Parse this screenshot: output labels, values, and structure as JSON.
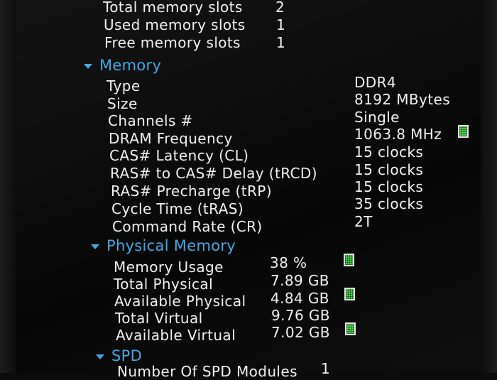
{
  "slots": {
    "total_label": "Total memory slots",
    "total_value": "2",
    "used_label": "Used memory slots",
    "used_value": "1",
    "free_label": "Free memory slots",
    "free_value": "1"
  },
  "memory": {
    "title": "Memory",
    "type_label": "Type",
    "type_value": "DDR4",
    "size_label": "Size",
    "size_value": "8192 MBytes",
    "channels_label": "Channels #",
    "channels_value": "Single",
    "freq_label": "DRAM Frequency",
    "freq_value": "1063.8 MHz",
    "cas_label": "CAS# Latency (CL)",
    "cas_value": "15 clocks",
    "trcd_label": "RAS# to CAS# Delay (tRCD)",
    "trcd_value": "15 clocks",
    "trp_label": "RAS# Precharge (tRP)",
    "trp_value": "15 clocks",
    "tras_label": "Cycle Time (tRAS)",
    "tras_value": "35 clocks",
    "cr_label": "Command Rate (CR)",
    "cr_value": "2T"
  },
  "physical": {
    "title": "Physical Memory",
    "usage_label": "Memory Usage",
    "usage_value": "38 %",
    "total_phys_label": "Total Physical",
    "total_phys_value": "7.89 GB",
    "avail_phys_label": "Available Physical",
    "avail_phys_value": "4.84 GB",
    "total_virt_label": "Total Virtual",
    "total_virt_value": "9.76 GB",
    "avail_virt_label": "Available Virtual",
    "avail_virt_value": "7.02 GB"
  },
  "spd": {
    "title": "SPD",
    "modules_label": "Number Of SPD Modules",
    "modules_value": "1"
  },
  "colors": {
    "section": "#41a8e6",
    "icon": "#5dd05d"
  },
  "icons": [
    "ram-icon"
  ]
}
